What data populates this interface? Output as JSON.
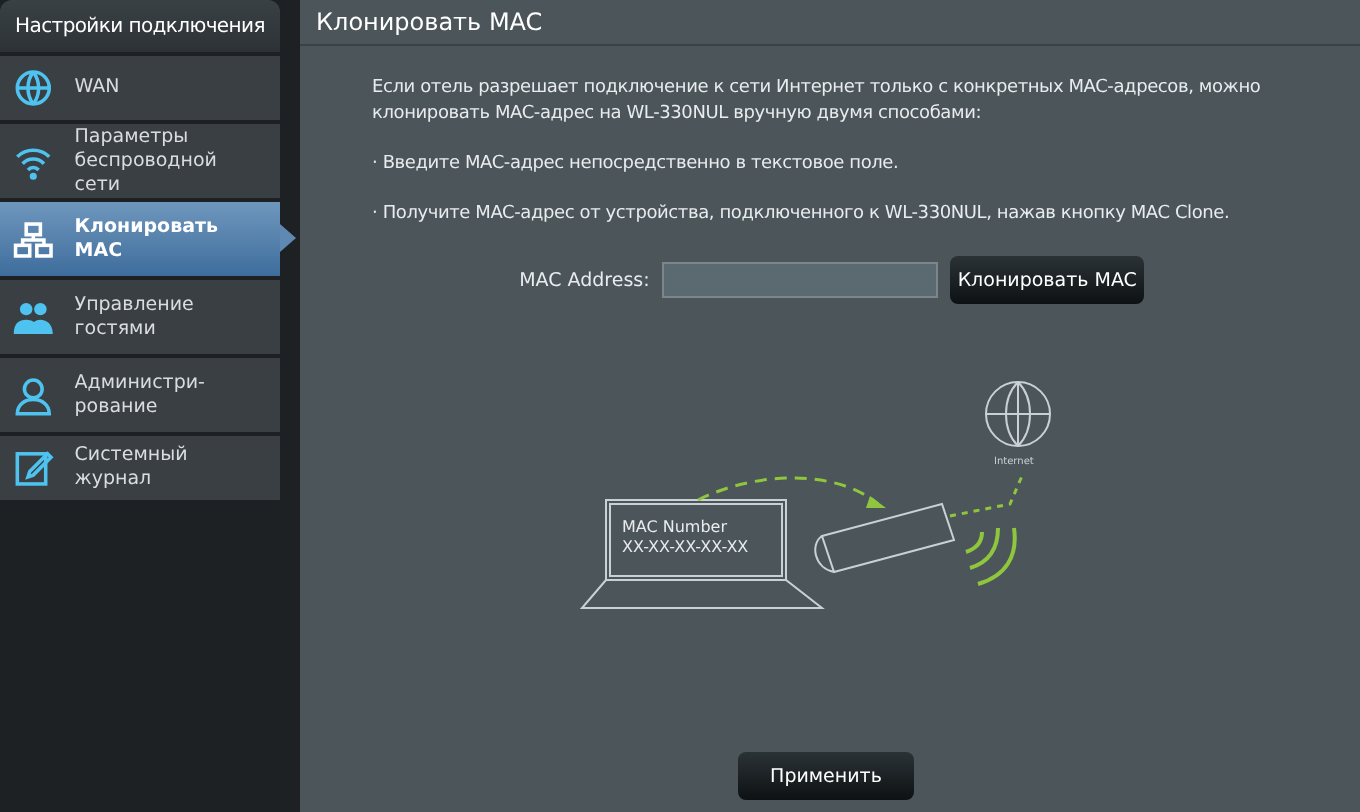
{
  "sidebar": {
    "title": "Настройки подключения",
    "items": [
      {
        "label": "WAN",
        "kind": "globe",
        "selected": false
      },
      {
        "label": "Параметры беспроводной сети",
        "kind": "wifi",
        "selected": false
      },
      {
        "label": "Клонировать MAC",
        "kind": "network",
        "selected": true
      },
      {
        "label": "Управление гостями",
        "kind": "guests",
        "selected": false
      },
      {
        "label": "Администри-рование",
        "kind": "user",
        "selected": false
      },
      {
        "label": "Системный журнал",
        "kind": "log",
        "selected": false
      }
    ]
  },
  "page": {
    "title": "Клонировать MAC",
    "paragraphs": [
      "Если отель разрешает подключение к сети Интернет только с конкретных MAC-адресов, можно клонировать MAC-адрес на WL-330NUL вручную двумя способами:",
      "· Введите MAC-адрес непосредственно в текстовое поле.",
      "· Получите MAC-адрес от устройства, подключенного к WL-330NUL, нажав кнопку MAC Clone."
    ],
    "mac_field": {
      "label": "MAC Address:"
    },
    "clone_button": "Клонировать MAC",
    "illustration": {
      "screen_line_1": "MAC Number",
      "screen_line_2": "XX-XX-XX-XX-XX",
      "internet_label": "Internet"
    },
    "apply_button": "Применить"
  }
}
